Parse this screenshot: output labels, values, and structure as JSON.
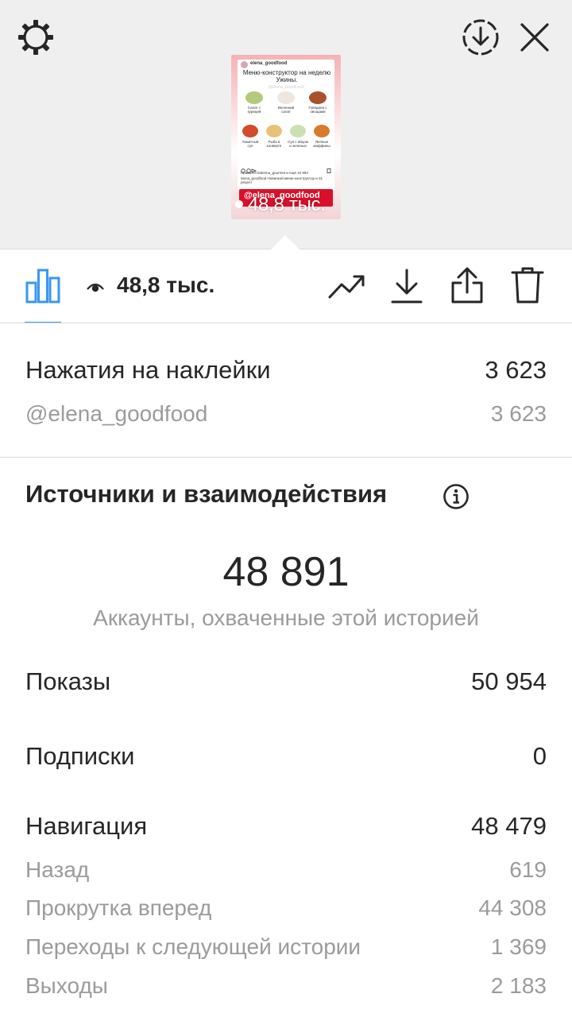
{
  "preview": {
    "views_overlay": "48,8 тыс.",
    "username": "elena_goodfood",
    "title": "Меню-конструктор на неделю Ужины.",
    "watermark": "@Elena_GoodFood",
    "dish_captions": [
      "Салат с курицей",
      "Весенний салат",
      "Говядина с овощами",
      "Томатный суп",
      "Рыба в конверте",
      "Суп с яйцом и зеленью",
      "Яичные маффины"
    ],
    "likes_line": "Нравится katerina_gourmet и ещё 10 994",
    "caption_line": "elena_goodfood Новинкой меню-конструктор и 31 рецепт",
    "bottom_tag": "@elena_goodfood"
  },
  "toolbar": {
    "views_value": "48,8 тыс.",
    "icons": [
      "settings-icon",
      "download-circle-icon",
      "close-icon",
      "bar-chart-icon",
      "eye-icon",
      "trending-icon",
      "download-icon",
      "share-icon",
      "trash-icon"
    ]
  },
  "sticker_taps": {
    "label": "Нажатия на наклейки",
    "value": "3 623",
    "items": [
      {
        "label": "@elena_goodfood",
        "value": "3 623"
      }
    ]
  },
  "discovery": {
    "title": "Источники и взаимодействия",
    "reach_value": "48 891",
    "reach_label": "Аккаунты, охваченные этой историей",
    "impressions": {
      "label": "Показы",
      "value": "50 954"
    },
    "follows": {
      "label": "Подписки",
      "value": "0"
    },
    "navigation": {
      "label": "Навигация",
      "value": "48 479",
      "items": [
        {
          "label": "Назад",
          "value": "619"
        },
        {
          "label": "Прокрутка вперед",
          "value": "44 308"
        },
        {
          "label": "Переходы к следующей истории",
          "value": "1 369"
        },
        {
          "label": "Выходы",
          "value": "2 183"
        }
      ]
    }
  },
  "colors": {
    "accent": "#3897f0",
    "bottom_tag_bg": "#d9102a"
  }
}
